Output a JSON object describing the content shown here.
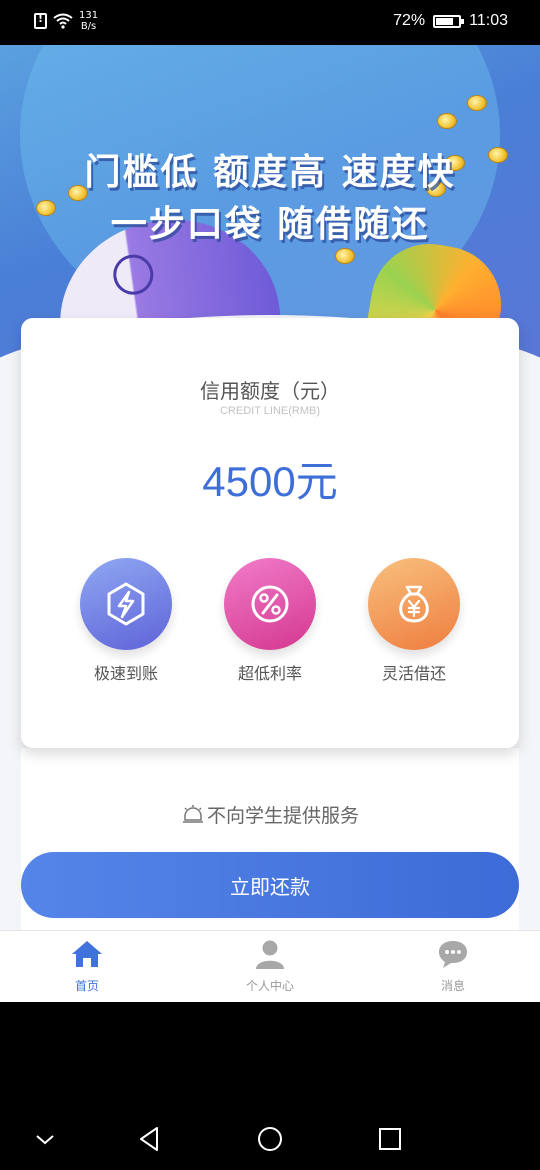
{
  "status": {
    "speed_value": "131",
    "speed_unit": "B/s",
    "battery": "72%",
    "time": "11:03"
  },
  "banner": {
    "line1": "门槛低 额度高 速度快",
    "line2": "一步口袋 随借随还"
  },
  "card": {
    "title": "信用额度（元）",
    "subtitle": "CREDIT LINE(RMB)",
    "amount": "4500元",
    "features": [
      {
        "label": "极速到账",
        "icon": "lightning-icon"
      },
      {
        "label": "超低利率",
        "icon": "percent-icon"
      },
      {
        "label": "灵活借还",
        "icon": "money-bag-icon"
      }
    ]
  },
  "notice": "不向学生提供服务",
  "repay_button": "立即还款",
  "tabs": [
    {
      "label": "首页",
      "icon": "home-icon"
    },
    {
      "label": "个人中心",
      "icon": "person-icon"
    },
    {
      "label": "消息",
      "icon": "chat-icon"
    }
  ],
  "colors": {
    "primary": "#3e6fd8",
    "inactive": "#999999"
  }
}
